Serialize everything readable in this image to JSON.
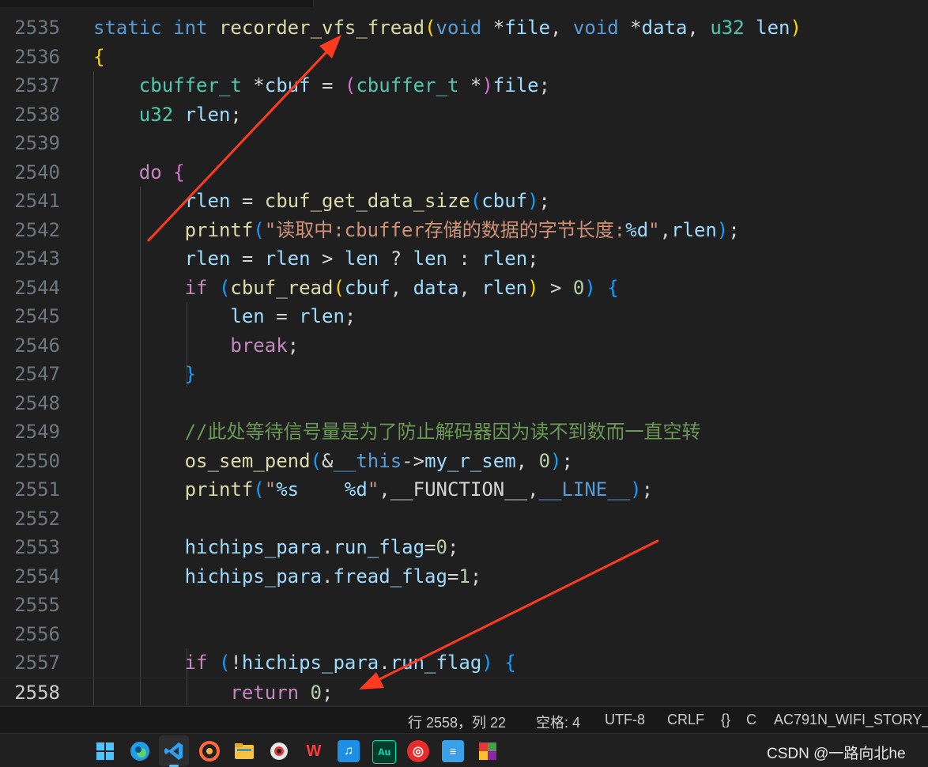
{
  "colors": {
    "keyword": "#569cd6",
    "control": "#c586c0",
    "function": "#dcdcaa",
    "variable": "#9cdcfe",
    "type": "#4ec9b0",
    "string": "#ce9178",
    "number": "#b5cea8",
    "comment": "#6a9955",
    "annotation_arrow": "#ff3b1f"
  },
  "editor": {
    "lines": [
      {
        "num": "2535",
        "tokens": [
          [
            "kw",
            "static"
          ],
          [
            "op",
            " "
          ],
          [
            "kw",
            "int"
          ],
          [
            "op",
            " "
          ],
          [
            "fn",
            "recorder_vfs_fread"
          ],
          [
            "b1",
            "("
          ],
          [
            "kw",
            "void"
          ],
          [
            "op",
            " *"
          ],
          [
            "var",
            "file"
          ],
          [
            "op",
            ", "
          ],
          [
            "kw",
            "void"
          ],
          [
            "op",
            " *"
          ],
          [
            "var",
            "data"
          ],
          [
            "op",
            ", "
          ],
          [
            "type",
            "u32"
          ],
          [
            "op",
            " "
          ],
          [
            "var",
            "len"
          ],
          [
            "b1",
            ")"
          ]
        ]
      },
      {
        "num": "2536",
        "tokens": [
          [
            "b1",
            "{"
          ]
        ]
      },
      {
        "num": "2537",
        "tokens": [
          [
            "op",
            "    "
          ],
          [
            "type",
            "cbuffer_t"
          ],
          [
            "op",
            " *"
          ],
          [
            "var",
            "cbuf"
          ],
          [
            "op",
            " = "
          ],
          [
            "b2",
            "("
          ],
          [
            "type",
            "cbuffer_t"
          ],
          [
            "op",
            " *"
          ],
          [
            "b2",
            ")"
          ],
          [
            "var",
            "file"
          ],
          [
            "op",
            ";"
          ]
        ]
      },
      {
        "num": "2538",
        "tokens": [
          [
            "op",
            "    "
          ],
          [
            "type",
            "u32"
          ],
          [
            "op",
            " "
          ],
          [
            "var",
            "rlen"
          ],
          [
            "op",
            ";"
          ]
        ]
      },
      {
        "num": "2539",
        "tokens": []
      },
      {
        "num": "2540",
        "tokens": [
          [
            "op",
            "    "
          ],
          [
            "ctl",
            "do"
          ],
          [
            "op",
            " "
          ],
          [
            "b2",
            "{"
          ]
        ]
      },
      {
        "num": "2541",
        "tokens": [
          [
            "op",
            "        "
          ],
          [
            "var",
            "rlen"
          ],
          [
            "op",
            " = "
          ],
          [
            "fn",
            "cbuf_get_data_size"
          ],
          [
            "b3",
            "("
          ],
          [
            "var",
            "cbuf"
          ],
          [
            "b3",
            ")"
          ],
          [
            "op",
            ";"
          ]
        ]
      },
      {
        "num": "2542",
        "tokens": [
          [
            "op",
            "        "
          ],
          [
            "fn",
            "printf"
          ],
          [
            "b3",
            "("
          ],
          [
            "str",
            "\"读取中:cbuffer存储的数据的字节长度:"
          ],
          [
            "var",
            "%d"
          ],
          [
            "str",
            "\""
          ],
          [
            "op",
            ","
          ],
          [
            "var",
            "rlen"
          ],
          [
            "b3",
            ")"
          ],
          [
            "op",
            ";"
          ]
        ]
      },
      {
        "num": "2543",
        "tokens": [
          [
            "op",
            "        "
          ],
          [
            "var",
            "rlen"
          ],
          [
            "op",
            " = "
          ],
          [
            "var",
            "rlen"
          ],
          [
            "op",
            " > "
          ],
          [
            "var",
            "len"
          ],
          [
            "op",
            " ? "
          ],
          [
            "var",
            "len"
          ],
          [
            "op",
            " : "
          ],
          [
            "var",
            "rlen"
          ],
          [
            "op",
            ";"
          ]
        ]
      },
      {
        "num": "2544",
        "tokens": [
          [
            "op",
            "        "
          ],
          [
            "ctl",
            "if"
          ],
          [
            "op",
            " "
          ],
          [
            "b3",
            "("
          ],
          [
            "fn",
            "cbuf_read"
          ],
          [
            "b1",
            "("
          ],
          [
            "var",
            "cbuf"
          ],
          [
            "op",
            ", "
          ],
          [
            "var",
            "data"
          ],
          [
            "op",
            ", "
          ],
          [
            "var",
            "rlen"
          ],
          [
            "b1",
            ")"
          ],
          [
            "op",
            " > "
          ],
          [
            "num",
            "0"
          ],
          [
            "b3",
            ")"
          ],
          [
            "op",
            " "
          ],
          [
            "b3",
            "{"
          ]
        ]
      },
      {
        "num": "2545",
        "tokens": [
          [
            "op",
            "            "
          ],
          [
            "var",
            "len"
          ],
          [
            "op",
            " = "
          ],
          [
            "var",
            "rlen"
          ],
          [
            "op",
            ";"
          ]
        ]
      },
      {
        "num": "2546",
        "tokens": [
          [
            "op",
            "            "
          ],
          [
            "ctl",
            "break"
          ],
          [
            "op",
            ";"
          ]
        ]
      },
      {
        "num": "2547",
        "tokens": [
          [
            "op",
            "        "
          ],
          [
            "b3",
            "}"
          ]
        ]
      },
      {
        "num": "2548",
        "tokens": []
      },
      {
        "num": "2549",
        "tokens": [
          [
            "op",
            "        "
          ],
          [
            "cm",
            "//此处等待信号量是为了防止解码器因为读不到数而一直空转"
          ]
        ]
      },
      {
        "num": "2550",
        "tokens": [
          [
            "op",
            "        "
          ],
          [
            "fn",
            "os_sem_pend"
          ],
          [
            "b3",
            "("
          ],
          [
            "op",
            "&"
          ],
          [
            "kw",
            "__this"
          ],
          [
            "op",
            "->"
          ],
          [
            "var",
            "my_r_sem"
          ],
          [
            "op",
            ", "
          ],
          [
            "num",
            "0"
          ],
          [
            "b3",
            ")"
          ],
          [
            "op",
            ";"
          ]
        ]
      },
      {
        "num": "2551",
        "tokens": [
          [
            "op",
            "        "
          ],
          [
            "fn",
            "printf"
          ],
          [
            "b3",
            "("
          ],
          [
            "str",
            "\""
          ],
          [
            "var",
            "%s"
          ],
          [
            "str",
            "    "
          ],
          [
            "var",
            "%d"
          ],
          [
            "str",
            "\""
          ],
          [
            "op",
            ","
          ],
          [
            "op",
            "__FUNCTION__"
          ],
          [
            "op",
            ","
          ],
          [
            "mac",
            "__LINE__"
          ],
          [
            "b3",
            ")"
          ],
          [
            "op",
            ";"
          ]
        ]
      },
      {
        "num": "2552",
        "tokens": []
      },
      {
        "num": "2553",
        "tokens": [
          [
            "op",
            "        "
          ],
          [
            "var",
            "hichips_para"
          ],
          [
            "op",
            "."
          ],
          [
            "var",
            "run_flag"
          ],
          [
            "op",
            "="
          ],
          [
            "num",
            "0"
          ],
          [
            "op",
            ";"
          ]
        ]
      },
      {
        "num": "2554",
        "tokens": [
          [
            "op",
            "        "
          ],
          [
            "var",
            "hichips_para"
          ],
          [
            "op",
            "."
          ],
          [
            "var",
            "fread_flag"
          ],
          [
            "op",
            "="
          ],
          [
            "num",
            "1"
          ],
          [
            "op",
            ";"
          ]
        ]
      },
      {
        "num": "2555",
        "tokens": []
      },
      {
        "num": "2556",
        "tokens": []
      },
      {
        "num": "2557",
        "tokens": [
          [
            "op",
            "        "
          ],
          [
            "ctl",
            "if"
          ],
          [
            "op",
            " "
          ],
          [
            "b3",
            "("
          ],
          [
            "op",
            "!"
          ],
          [
            "var",
            "hichips_para"
          ],
          [
            "op",
            "."
          ],
          [
            "var",
            "run_flag"
          ],
          [
            "b3",
            ")"
          ],
          [
            "op",
            " "
          ],
          [
            "b3",
            "{"
          ]
        ]
      },
      {
        "num": "2558",
        "tokens": [
          [
            "op",
            "            "
          ],
          [
            "ctl",
            "return"
          ],
          [
            "op",
            " "
          ],
          [
            "num",
            "0"
          ],
          [
            "op",
            ";"
          ]
        ]
      }
    ]
  },
  "statusbar": {
    "position": "行 2558，列 22",
    "indent": "空格: 4",
    "encoding": "UTF-8",
    "eol": "CRLF",
    "language_icon": "{}",
    "language": "C",
    "project": "AC791N_WIFI_STORY_"
  },
  "taskbar": {
    "icons": [
      "windows-start-icon",
      "edge-icon",
      "vscode-icon",
      "swirl-app-icon",
      "file-explorer-icon",
      "snipping-icon",
      "wps-icon",
      "music-app-icon",
      "audition-icon",
      "netease-music-icon",
      "notepad-icon",
      "color-app-icon"
    ],
    "watermark": "CSDN @一路向北he"
  }
}
